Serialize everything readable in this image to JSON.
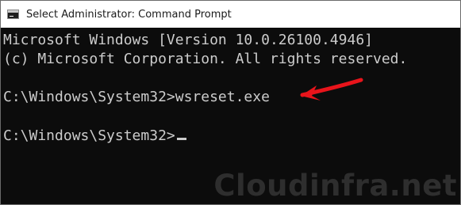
{
  "window": {
    "title": "Select Administrator: Command Prompt",
    "app_icon": "cmd-icon"
  },
  "console": {
    "lines": [
      "Microsoft Windows [Version 10.0.26100.4946]",
      "(c) Microsoft Corporation. All rights reserved.",
      "",
      "C:\\Windows\\System32>wsreset.exe",
      "",
      "C:\\Windows\\System32>"
    ],
    "text_color": "#cccccc",
    "background_color": "#0c0c0c"
  },
  "annotation": {
    "arrow_color": "#e8141b",
    "arrow_icon": "arrow-left-icon"
  },
  "watermark": {
    "text": "Cloudinfra.net"
  }
}
